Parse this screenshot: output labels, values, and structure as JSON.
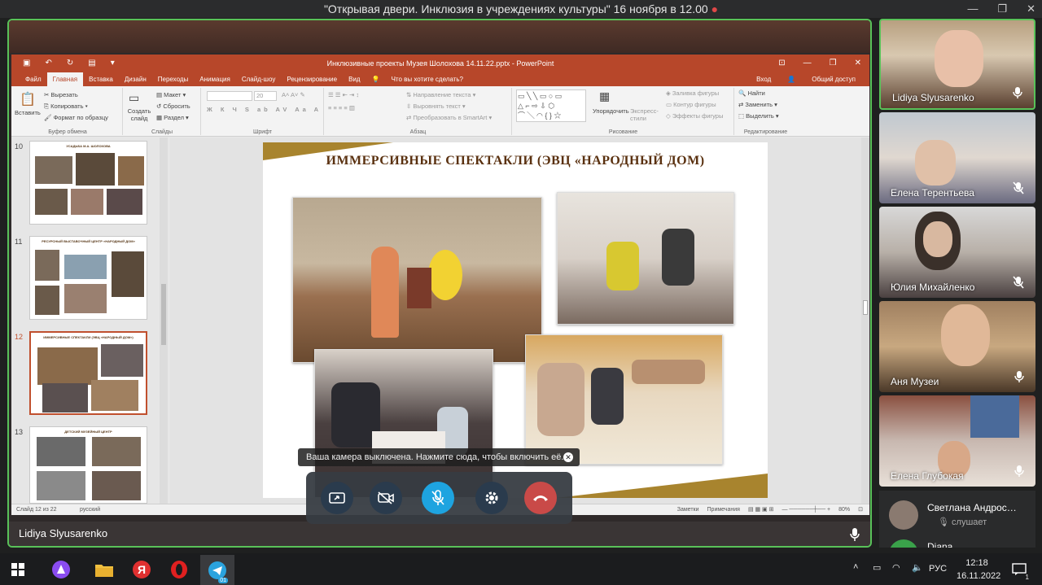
{
  "window": {
    "title": "\"Открывая двери. Инклюзия в учреждениях культуры\" 16 ноября в 12.00",
    "rec_dot": "●",
    "controls": [
      "—",
      "❐",
      "✕"
    ]
  },
  "ppt": {
    "filename": "Инклюзивные проекты Музея Шолохова 14.11.22.pptx - PowerPoint",
    "menu": [
      "Файл",
      "Главная",
      "Вставка",
      "Дизайн",
      "Переходы",
      "Анимация",
      "Слайд-шоу",
      "Рецензирование",
      "Вид"
    ],
    "active_menu": "Главная",
    "search_hint": "Что вы хотите сделать?",
    "sign_in": "Вход",
    "share": "Общий доступ",
    "ribbon": {
      "paste": "Вставить",
      "cut": "Вырезать",
      "copy": "Копировать",
      "format_painter": "Формат по образцу",
      "clipboard_group": "Буфер обмена",
      "new_slide": "Создать слайд",
      "layout": "Макет",
      "reset": "Сбросить",
      "section": "Раздел",
      "slides_group": "Слайды",
      "font_size": "20",
      "font_group": "Шрифт",
      "text_direction": "Направление текста",
      "align_text": "Выровнять текст",
      "smartart": "Преобразовать в SmartArt",
      "paragraph_group": "Абзац",
      "arrange": "Упорядочить",
      "quick_styles": "Экспресс-стили",
      "fill": "Заливка фигуры",
      "outline": "Контур фигуры",
      "effects": "Эффекты фигуры",
      "drawing_group": "Рисование",
      "find": "Найти",
      "replace": "Заменить",
      "select": "Выделить",
      "editing_group": "Редактирование"
    },
    "thumbs": [
      {
        "num": "10",
        "caption": "УСАДЬБА М.А. ШОЛОХОВА"
      },
      {
        "num": "11",
        "caption": "РЕСУРСНЫЙ ВЫСТАВОЧНЫЙ ЦЕНТР «НАРОДНЫЙ ДОМ»"
      },
      {
        "num": "12",
        "caption": "ИММЕРСИВНЫЕ СПЕКТАКЛИ (ЭВЦ «НАРОДНЫЙ ДОМ»)"
      },
      {
        "num": "13",
        "caption": "ДЕТСКИЙ МУЗЕЙНЫЙ ЦЕНТР"
      }
    ],
    "slide_title": "ИММЕРСИВНЫЕ СПЕКТАКЛИ (ЭВЦ «НАРОДНЫЙ ДОМ)",
    "status": {
      "slide_of": "Слайд 12 из 22",
      "language": "русский",
      "notes": "Заметки",
      "comments": "Примечания",
      "zoom": "80%"
    }
  },
  "call": {
    "camera_toast": "Ваша камера выключена. Нажмите сюда, чтобы включить её.",
    "speaker_name": "Lidiya Slyusarenko",
    "participants": [
      {
        "name": "Lidiya Slyusarenko",
        "muted": false
      },
      {
        "name": "Елена Терентьева",
        "muted": true
      },
      {
        "name": "Юлия Михайленко",
        "muted": true
      },
      {
        "name": "Аня Музеи",
        "muted": false
      },
      {
        "name": "Елена Глубокая",
        "muted": false
      }
    ],
    "list": [
      {
        "name": "Светлана Андрос…",
        "status": "слушает"
      },
      {
        "name": "Diana"
      }
    ]
  },
  "taskbar": {
    "language": "РУС",
    "time": "12:18",
    "date": "16.11.2022",
    "notif_count": "1",
    "telegram_badge": "01"
  },
  "colors": {
    "ppt_accent": "#b7472a",
    "active_border": "#59c259",
    "mic_button": "#1ea4e0",
    "hangup_button": "#c94a48"
  }
}
